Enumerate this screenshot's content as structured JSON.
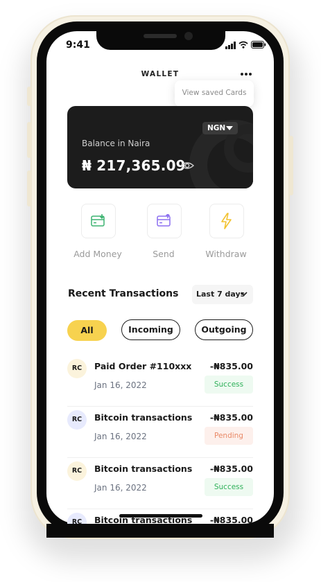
{
  "status_bar": {
    "time": "9:41",
    "signal_icon": "signal-icon",
    "wifi_icon": "wifi-icon",
    "battery_icon": "battery-icon"
  },
  "header": {
    "title": "WALLET",
    "menu_icon": "more-horizontal-icon"
  },
  "menu": {
    "items": [
      {
        "label": "View saved Cards"
      }
    ]
  },
  "balance_card": {
    "currency": "NGN",
    "label": "Balance in Naira",
    "amount": "₦ 217,365.09",
    "visibility_icon": "eye-icon"
  },
  "actions": [
    {
      "label": "Add Money",
      "icon": "add-money-icon",
      "color": "#3cb371"
    },
    {
      "label": "Send",
      "icon": "send-icon",
      "color": "#8b6ff0"
    },
    {
      "label": "Withdraw",
      "icon": "lightning-icon",
      "color": "#f2c230"
    }
  ],
  "transactions_section": {
    "title": "Recent Transactions",
    "range": "Last 7 days"
  },
  "filters": [
    {
      "label": "All",
      "active": true
    },
    {
      "label": "Incoming",
      "active": false
    },
    {
      "label": "Outgoing",
      "active": false
    }
  ],
  "transactions": [
    {
      "initials": "RC",
      "name": "Paid Order #110xxx",
      "amount": "-₦835.00",
      "date": "Jan 16, 2022",
      "status": "Success"
    },
    {
      "initials": "RC",
      "name": "Bitcoin transactions",
      "amount": "-₦835.00",
      "date": "Jan 16, 2022",
      "status": "Pending"
    },
    {
      "initials": "RC",
      "name": "Bitcoin transactions",
      "amount": "-₦835.00",
      "date": "Jan 16, 2022",
      "status": "Success"
    },
    {
      "initials": "RC",
      "name": "Bitcoin transactions",
      "amount": "-₦835.00",
      "date": "",
      "status": ""
    }
  ],
  "colors": {
    "accent": "#f7d24f",
    "card": "#1c1c1c",
    "success": "#2fb15a",
    "pending": "#e98967"
  }
}
